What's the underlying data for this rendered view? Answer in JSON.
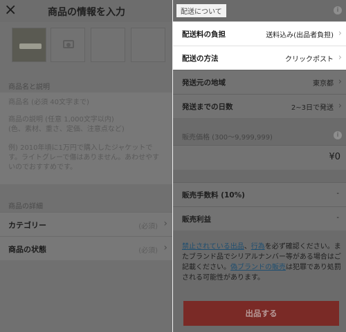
{
  "left": {
    "title": "商品の情報を入力",
    "close_icon": "×",
    "photo_icon": "camera-icon",
    "name_section_label": "商品名と説明",
    "name_placeholder": "商品名 (必須 40文字まで)",
    "desc_placeholder_1": "商品の説明 (任意 1,000文字以内)",
    "desc_placeholder_2": "(色、素材、重さ、定価、注意点など)",
    "example_1": "例) 2010年頃に1万円で購入したジャケットで",
    "example_2": "す。ライトグレーで傷はありません。あわせやす",
    "example_3": "いのでおすすめです。",
    "detail_section_label": "商品の詳細",
    "category_label": "カテゴリー",
    "category_req": "(必須)",
    "condition_label": "商品の状態",
    "condition_req": "(必須)"
  },
  "right": {
    "shipping_header": "配送について",
    "shipping_fee_label": "配送料の負担",
    "shipping_fee_value": "送料込み(出品者負担)",
    "shipping_method_label": "配送の方法",
    "shipping_method_value": "クリックポスト",
    "origin_label": "発送元の地域",
    "origin_value": "東京都",
    "days_label": "発送までの日数",
    "days_value": "2~3日で発送",
    "price_label": "販売価格 (300〜9,999,999)",
    "price_value": "¥0",
    "fee_label": "販売手数料 (10%)",
    "fee_value": "-",
    "profit_label": "販売利益",
    "profit_value": "-",
    "note_link_1": "禁止されている出品",
    "note_sep": "、",
    "note_link_2": "行為",
    "note_text_1": "を必ず確認ください。またブランド品でシリアルナンバー等がある場合はご記載ください。",
    "note_link_3": "偽ブランドの販売",
    "note_text_2": "は犯罪であり処罰される可能性があります。",
    "submit_label": "出品する",
    "info_icon": "i"
  },
  "colors": {
    "accent": "#e53a30",
    "link": "#0d77c7"
  }
}
